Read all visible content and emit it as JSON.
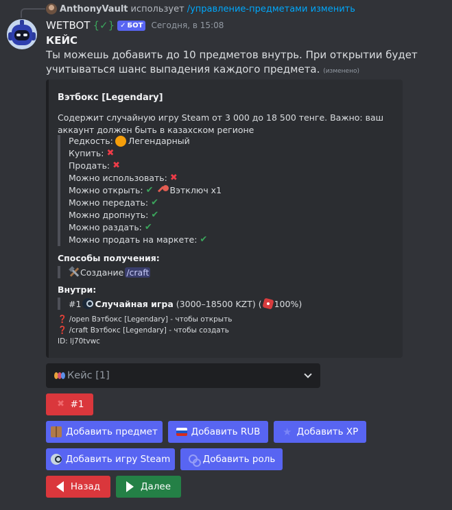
{
  "reply": {
    "user": "AnthonyVault",
    "action": "использует",
    "command": "/управление-предметами изменить"
  },
  "message": {
    "author": "WETBOT",
    "author_tag": "{✓}",
    "badge": "БОТ",
    "timestamp": "Сегодня, в 15:08",
    "title": "КЕЙС",
    "body": "Ты можешь добавить до 10 предметов внутрь. При открытии будет учитываться шанс выпадения каждого предмета.",
    "edited": "(изменено)"
  },
  "embed": {
    "title": "Вэтбокс [Legendary]",
    "description": "Содержит случайную игру Steam от 3 000 до 18 500 тенге. Важно: ваш аккаунт должен быть в казахском регионе",
    "properties": [
      {
        "label": "Редкость:",
        "value": "Легендарный",
        "icon": "orange-circle-icon"
      },
      {
        "label": "Купить:",
        "mark": "cross"
      },
      {
        "label": "Продать:",
        "mark": "cross"
      },
      {
        "label": "Можно использовать:",
        "mark": "cross"
      },
      {
        "label": "Можно открыть:",
        "mark": "check",
        "extra": "Вэтключ x1",
        "extra_icon": "key-icon"
      },
      {
        "label": "Можно передать:",
        "mark": "check"
      },
      {
        "label": "Можно дропнуть:",
        "mark": "check"
      },
      {
        "label": "Можно раздать:",
        "mark": "check"
      },
      {
        "label": "Можно продать на маркете:",
        "mark": "check"
      }
    ],
    "obtain_title": "Способы получения:",
    "obtain_text": "Создание",
    "obtain_command": "/craft",
    "inside_title": "Внутри:",
    "inside_index": "#1",
    "inside_name": "Случайная игра",
    "inside_range": "(3000–18500 KZT) (",
    "inside_chance": "100%)",
    "cmd_open": "/open Вэтбокс [Legendary] - чтобы открыть",
    "cmd_craft": "/craft Вэтбокс [Legendary] - чтобы создать",
    "id_line": "ID: lj70tvwc",
    "check_symbol": "✔",
    "cross_symbol": "✖",
    "question_symbol": "❓"
  },
  "select": {
    "label": "Кейс [1]"
  },
  "buttons": {
    "item1": "#1",
    "add_item": "Добавить предмет",
    "add_rub": "Добавить RUB",
    "add_xp": "Добавить XP",
    "add_steam": "Добавить игру Steam",
    "add_role": "Добавить роль",
    "back": "Назад",
    "next": "Далее"
  },
  "colors": {
    "background": "#313338",
    "embed_bg": "#2b2d31",
    "blurple": "#5865f2",
    "danger": "#da373c",
    "success": "#248046",
    "link": "#00a8fc"
  }
}
